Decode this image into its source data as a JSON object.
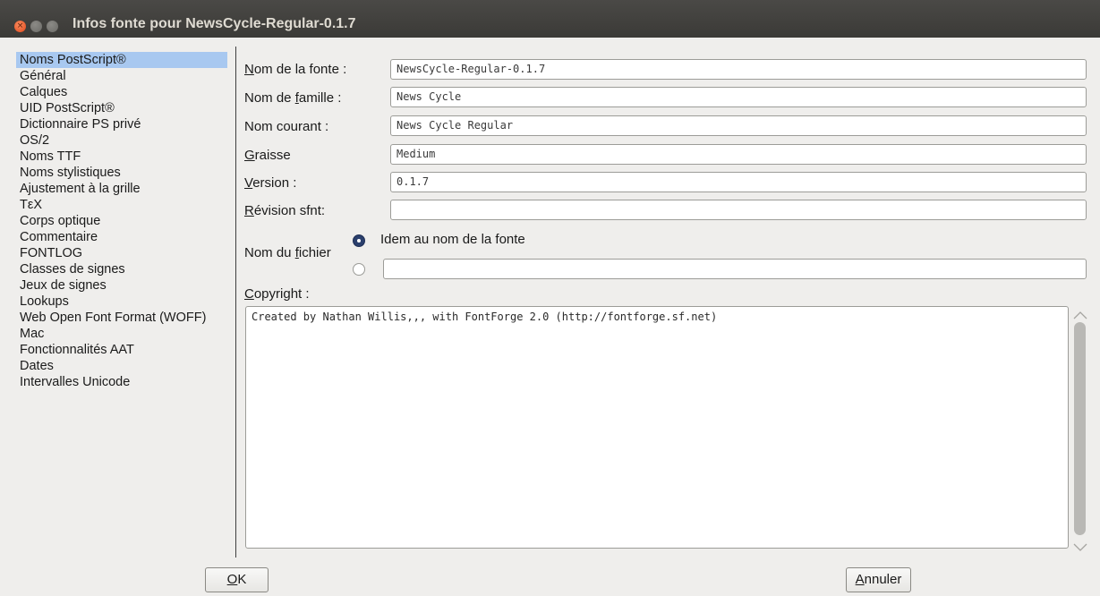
{
  "window": {
    "title": "Infos fonte pour NewsCycle-Regular-0.1.7",
    "close_glyph": "×"
  },
  "sidebar": {
    "items": [
      {
        "label": "Noms PostScript®",
        "selected": true
      },
      {
        "label": "Général"
      },
      {
        "label": "Calques"
      },
      {
        "label": "UID PostScript®"
      },
      {
        "label": "Dictionnaire PS privé"
      },
      {
        "label": "OS/2"
      },
      {
        "label": "Noms TTF"
      },
      {
        "label": "Noms stylistiques"
      },
      {
        "label": "Ajustement à la grille"
      },
      {
        "label": "TεX"
      },
      {
        "label": "Corps optique"
      },
      {
        "label": "Commentaire"
      },
      {
        "label": "FONTLOG"
      },
      {
        "label": "Classes de signes"
      },
      {
        "label": "Jeux de signes"
      },
      {
        "label": "Lookups"
      },
      {
        "label": "Web Open Font Format (WOFF)"
      },
      {
        "label": "Mac"
      },
      {
        "label": "Fonctionnalités AAT"
      },
      {
        "label": "Dates"
      },
      {
        "label": "Intervalles Unicode"
      }
    ]
  },
  "form": {
    "font_name": {
      "pre": "",
      "ul": "N",
      "post": "om de la fonte :",
      "value": "NewsCycle-Regular-0.1.7"
    },
    "family_name": {
      "pre": "Nom de ",
      "ul": "f",
      "post": "amille :",
      "value": "News Cycle"
    },
    "full_name": {
      "pre": "Nom courant :",
      "ul": "",
      "post": "",
      "value": "News Cycle Regular"
    },
    "weight": {
      "pre": "",
      "ul": "G",
      "post": "raisse",
      "value": "Medium"
    },
    "version": {
      "pre": "",
      "ul": "V",
      "post": "ersion :",
      "value": "0.1.7"
    },
    "sfnt_revision": {
      "pre": "",
      "ul": "R",
      "post": "évision sfnt:",
      "value": ""
    },
    "file_name": {
      "pre": "Nom du ",
      "ul": "f",
      "post": "ichier",
      "option_same": "Idem au nom de la fonte",
      "custom_value": ""
    },
    "copyright": {
      "pre": "",
      "ul": "C",
      "post": "opyright :",
      "value": "Created by Nathan Willis,,, with FontForge 2.0 (http://fontforge.sf.net)"
    }
  },
  "buttons": {
    "ok": {
      "ul": "O",
      "post": "K"
    },
    "cancel": {
      "ul": "A",
      "post": "nnuler"
    }
  },
  "colors": {
    "selection": "#a8c8f0",
    "radio_selected": "#2a3f6c",
    "window_bg": "#efeeec",
    "titlebar_bg": "#3c3b37",
    "close_button": "#e2491d"
  }
}
